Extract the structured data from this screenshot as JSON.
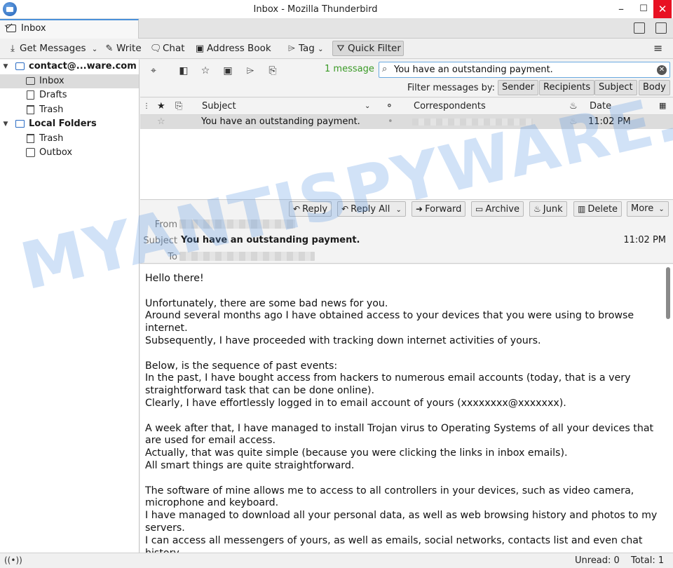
{
  "window": {
    "title": "Inbox - Mozilla Thunderbird",
    "minimize": "–",
    "maximize": "☐",
    "close": "✕"
  },
  "tabs": [
    {
      "label": "Inbox"
    }
  ],
  "toolbar": {
    "get_messages": "Get Messages",
    "write": "Write",
    "chat": "Chat",
    "address_book": "Address Book",
    "tag": "Tag",
    "quick_filter": "Quick Filter"
  },
  "folders": {
    "account": "contact@...ware.com",
    "inbox": "Inbox",
    "drafts": "Drafts",
    "trash": "Trash",
    "local_folders": "Local Folders",
    "local_trash": "Trash",
    "outbox": "Outbox"
  },
  "quick_filter": {
    "count": "1 message",
    "search_value": "You have an outstanding payment.",
    "filter_by_label": "Filter messages by:",
    "buttons": [
      "Sender",
      "Recipients",
      "Subject",
      "Body"
    ]
  },
  "thread": {
    "columns": {
      "subject": "Subject",
      "correspondents": "Correspondents",
      "date": "Date"
    },
    "rows": [
      {
        "subject": "You have an outstanding payment.",
        "date": "11:02 PM"
      }
    ]
  },
  "message": {
    "buttons": {
      "reply": "Reply",
      "reply_all": "Reply All",
      "forward": "Forward",
      "archive": "Archive",
      "junk": "Junk",
      "delete": "Delete",
      "more": "More"
    },
    "labels": {
      "from": "From",
      "subject": "Subject",
      "to": "To"
    },
    "subject": "You have an outstanding payment.",
    "time": "11:02 PM",
    "body": [
      "Hello there!",
      "",
      "Unfortunately, there are some bad news for you.",
      "Around several months ago I have obtained access to your devices that you were using to browse internet.",
      "Subsequently, I have proceeded with tracking down internet activities of yours.",
      "",
      "Below, is the sequence of past events:",
      "In the past, I have bought access from hackers to numerous email accounts (today, that is a very straightforward task that can be done online).",
      "Clearly, I have effortlessly logged in to email account of yours (xxxxxxxx@xxxxxxx).",
      "",
      "A week after that, I have managed to install Trojan virus to Operating Systems of all your devices that are used for email access.",
      "Actually, that was quite simple (because you were clicking the links in inbox emails).",
      "All smart things are quite straightforward.",
      "",
      "The software of mine allows me to access to all controllers in your devices, such as video camera, microphone and keyboard.",
      "I have managed to download all your personal data, as well as web browsing history and photos to my servers.",
      "I can access all messengers of yours, as well as emails, social networks, contacts list and even chat history."
    ]
  },
  "status": {
    "unread": "Unread: 0",
    "total": "Total: 1"
  },
  "watermark": "MYANTISPYWARE.COM"
}
